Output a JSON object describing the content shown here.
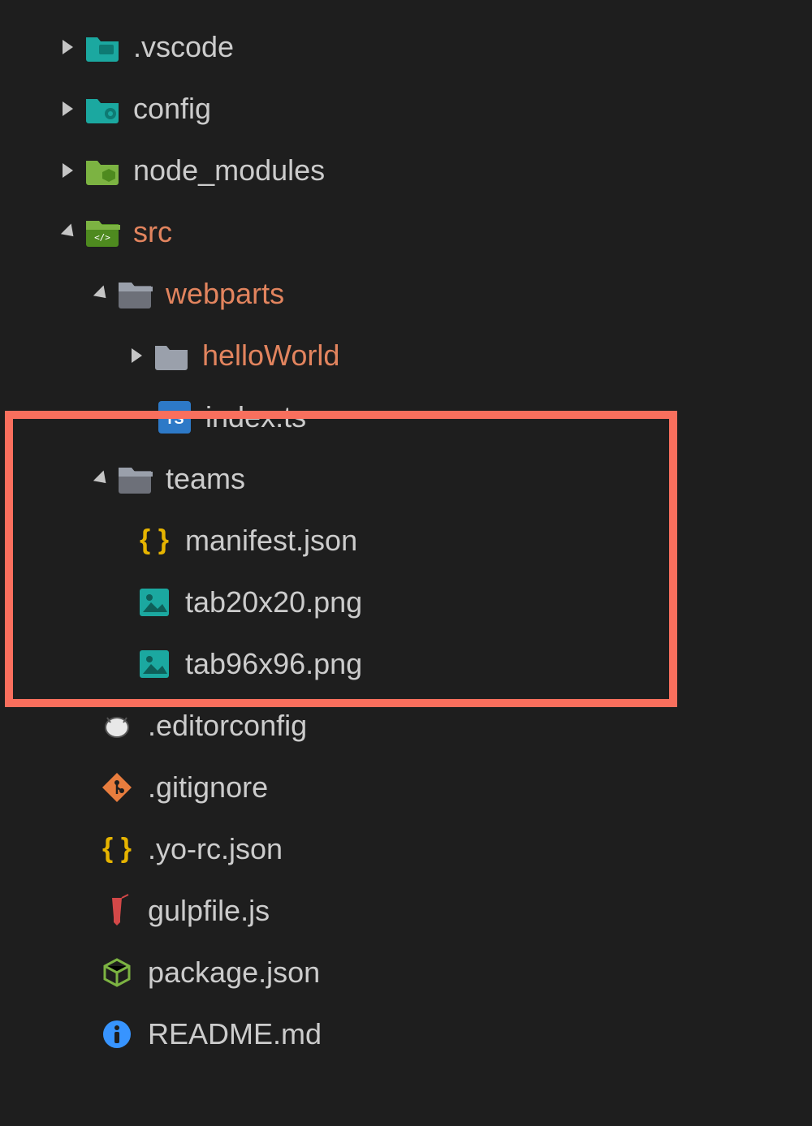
{
  "tree": {
    "vscode": ".vscode",
    "config": "config",
    "node_modules": "node_modules",
    "src": "src",
    "webparts": "webparts",
    "helloWorld": "helloWorld",
    "index_ts": "index.ts",
    "teams": "teams",
    "manifest_json": "manifest.json",
    "tab20": "tab20x20.png",
    "tab96": "tab96x96.png",
    "editorconfig": ".editorconfig",
    "gitignore": ".gitignore",
    "yo_rc": ".yo-rc.json",
    "gulpfile": "gulpfile.js",
    "package_json": "package.json",
    "readme": "README.md"
  },
  "colors": {
    "highlight": "#f96f5d",
    "modified": "#e2845e",
    "teal": "#1ba8a0",
    "green": "#7cb342",
    "orange": "#e87d3e",
    "yellow": "#e6b400",
    "blue": "#3794ff",
    "red": "#d34848"
  }
}
